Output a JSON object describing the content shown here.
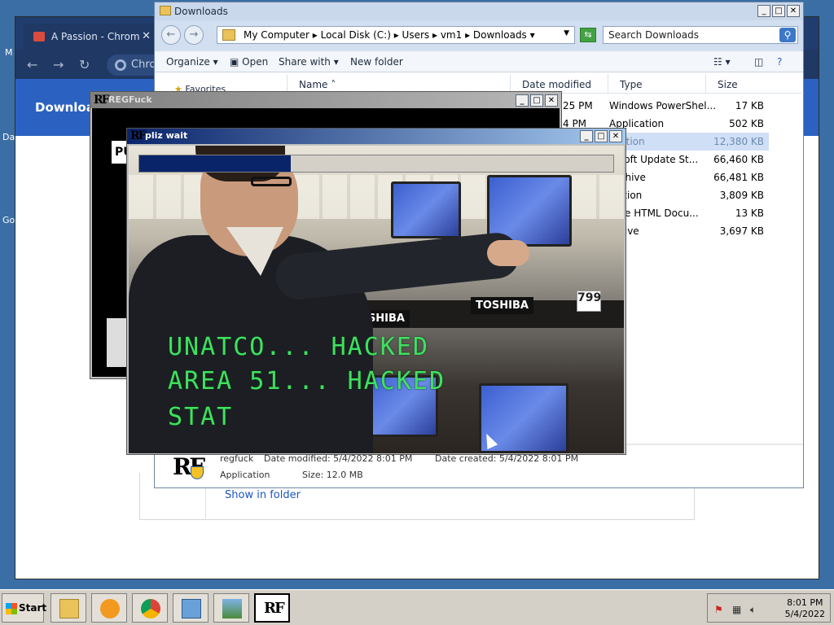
{
  "desktop": {
    "label_m": "M",
    "label_da": "Da",
    "label_go": "Go"
  },
  "chrome": {
    "tab_title": "A Passion - Chrom",
    "omnibox_text": "Chro",
    "header_title": "Download",
    "show_in_folder": "Show in folder"
  },
  "explorer": {
    "title": "Downloads",
    "breadcrumb": [
      "My Computer",
      "Local Disk (C:)",
      "Users",
      "vm1",
      "Downloads"
    ],
    "search_placeholder": "Search Downloads",
    "commands": {
      "organize": "Organize",
      "open": "Open",
      "share_with": "Share with",
      "new_folder": "New folder"
    },
    "favorites": "Favorites",
    "columns": {
      "name": "Name",
      "date": "Date modified",
      "type": "Type",
      "size": "Size"
    },
    "rows": [
      {
        "date": "25 PM",
        "type": "Windows PowerShel...",
        "size": "17 KB"
      },
      {
        "date": "4 PM",
        "type": "Application",
        "size": "502 KB"
      },
      {
        "date": "",
        "type": "lication",
        "size": "12,380 KB"
      },
      {
        "date": "",
        "type": "rosoft Update St...",
        "size": "66,460 KB"
      },
      {
        "date": "",
        "type": "Archive",
        "size": "66,481 KB"
      },
      {
        "date": "",
        "type": "ication",
        "size": "3,809 KB"
      },
      {
        "date": "",
        "type": "ome HTML Docu...",
        "size": "13 KB"
      },
      {
        "date": "",
        "type": "rchive",
        "size": "3,697 KB"
      }
    ],
    "details": {
      "name": "regfuck",
      "date_modified": "Date modified: 5/4/2022 8:01 PM",
      "date_created": "Date created: 5/4/2022 8:01 PM",
      "type": "Application",
      "size": "Size: 12.0 MB"
    }
  },
  "regfuck": {
    "title": "REGFuck",
    "icon_text": "RF",
    "pu_text": "PU"
  },
  "pliz": {
    "title": "pliz wait",
    "icon_text": "RF",
    "progress": 0.32,
    "hack_lines": [
      "UNATCO... HACKED",
      "AREA 51... HACKED",
      "STAT"
    ],
    "photo_brands": [
      "TOSHIBA",
      "TOSHIBA"
    ],
    "price_tag": "799"
  },
  "taskbar": {
    "start_label": "Start",
    "apps": [
      "file-explorer",
      "media-player",
      "chrome",
      "control-panel",
      "photo-viewer",
      "regfuck"
    ],
    "time": "8:01 PM",
    "date": "5/4/2022"
  },
  "colors": {
    "desktop": "#3a6ea5",
    "hack_text": "#40e060",
    "progress": "#0a246a",
    "chrome_header": "#2b62c2"
  }
}
